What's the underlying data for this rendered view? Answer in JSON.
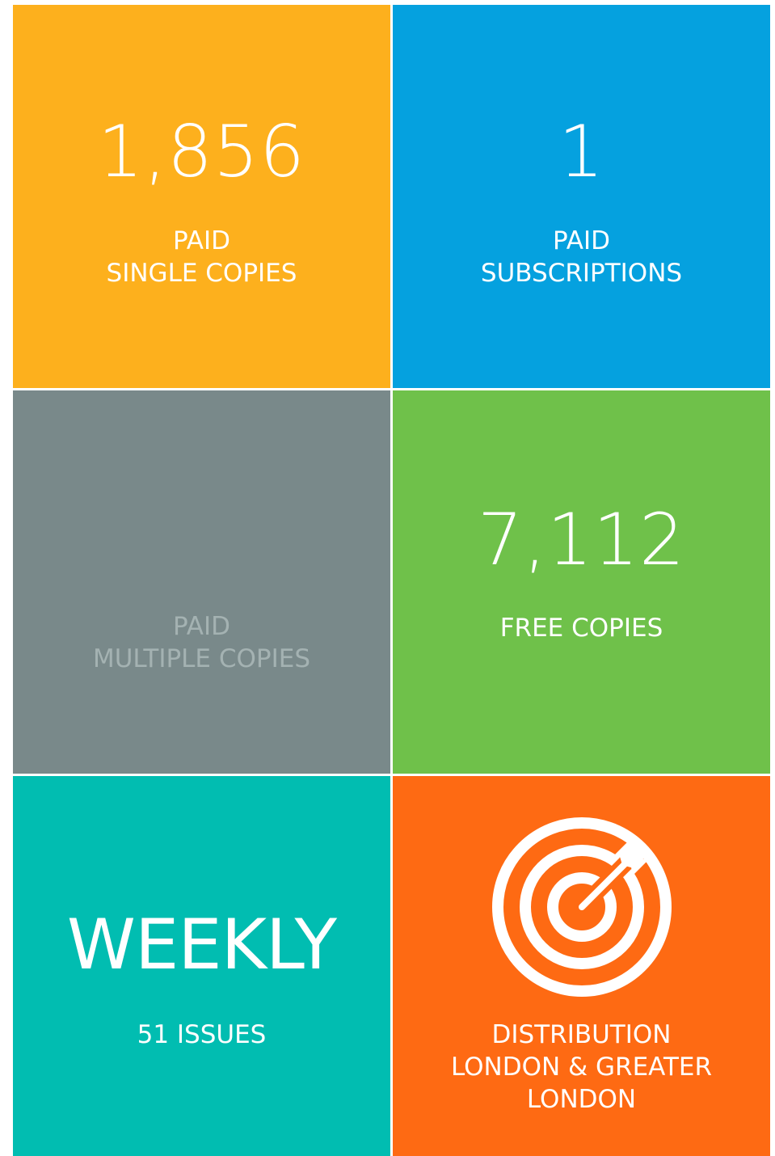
{
  "tiles": {
    "single_copies": {
      "value": "1,856",
      "label_line1": "PAID",
      "label_line2": "SINGLE COPIES",
      "color": "#fdb01d"
    },
    "subscriptions": {
      "value": "1",
      "label_line1": "PAID",
      "label_line2": "SUBSCRIPTIONS",
      "color": "#05a1df"
    },
    "multiple_copies": {
      "label_line1": "PAID",
      "label_line2": "MULTIPLE COPIES",
      "color": "#79898a"
    },
    "free_copies": {
      "value": "7,112",
      "label": "FREE COPIES",
      "color": "#6fc14a"
    },
    "frequency": {
      "value": "WEEKLY",
      "label": "51 ISSUES",
      "color": "#01bdb1"
    },
    "distribution": {
      "icon": "target-icon",
      "label_line1": "DISTRIBUTION",
      "label_line2": "LONDON & GREATER",
      "label_line3": "LONDON",
      "color": "#fe6a13"
    }
  }
}
